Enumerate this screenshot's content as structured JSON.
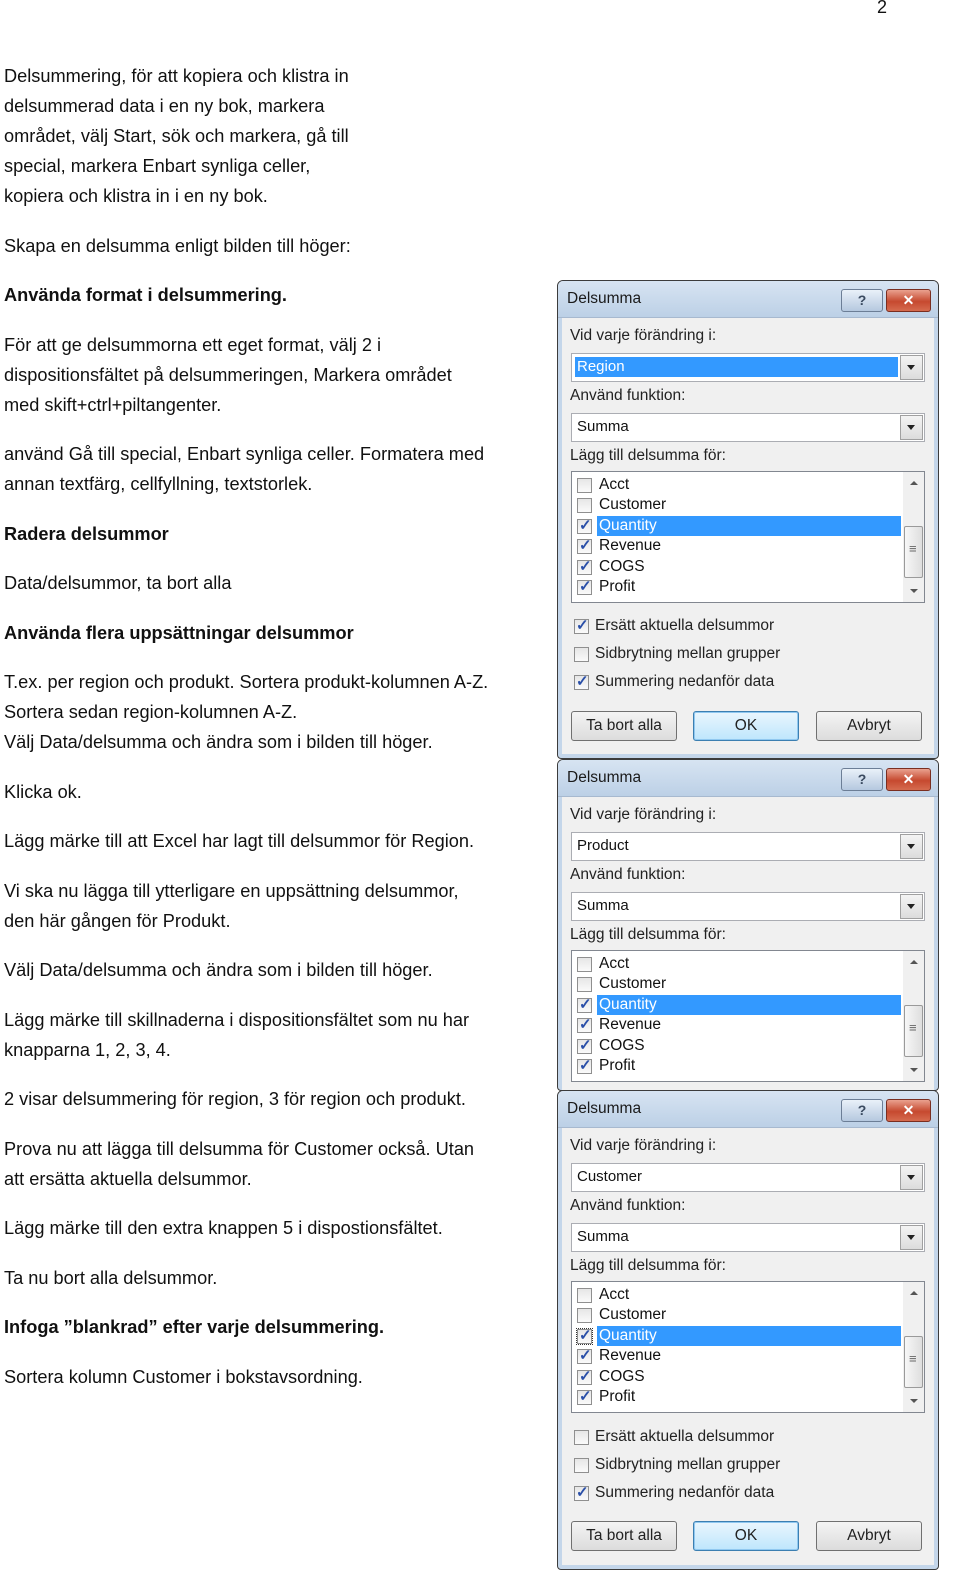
{
  "page_number": "2",
  "paragraphs": [
    {
      "bold": false,
      "lines": [
        "Delsummering, för att kopiera och klistra in",
        "delsummerad data i en ny bok, markera",
        "området, välj Start, sök och markera, gå till",
        "special, markera Enbart synliga celler,",
        "kopiera och klistra in i en ny bok."
      ]
    },
    {
      "bold": false,
      "lines": [
        "Skapa en delsumma enligt bilden till höger:"
      ]
    },
    {
      "bold": true,
      "lines": [
        "Använda format i delsummering."
      ]
    },
    {
      "bold": false,
      "lines": [
        "För att ge delsummorna ett eget format, välj 2 i",
        "dispositionsfältet på delsummeringen, Markera området",
        "med skift+ctrl+piltangenter."
      ]
    },
    {
      "bold": false,
      "lines": [
        "använd Gå till special, Enbart synliga celler. Formatera med",
        "annan textfärg, cellfyllning, textstorlek."
      ]
    },
    {
      "bold": true,
      "lines": [
        "Radera delsummor"
      ]
    },
    {
      "bold": false,
      "lines": [
        "Data/delsummor, ta bort alla"
      ]
    },
    {
      "bold": true,
      "lines": [
        "Använda flera uppsättningar delsummor"
      ]
    },
    {
      "bold": false,
      "lines": [
        "T.ex. per region och produkt. Sortera produkt-kolumnen A-Z.",
        "Sortera sedan region-kolumnen A-Z.",
        "Välj Data/delsumma och ändra som i bilden till höger."
      ]
    },
    {
      "bold": false,
      "lines": [
        "Klicka ok."
      ]
    },
    {
      "bold": false,
      "lines": [
        "Lägg märke till att Excel har lagt till delsummor för Region."
      ]
    },
    {
      "bold": false,
      "lines": [
        "Vi ska nu lägga till ytterligare en uppsättning delsummor,",
        "den här gången för Produkt."
      ]
    },
    {
      "bold": false,
      "lines": [
        "Välj Data/delsumma och ändra som i bilden till höger."
      ]
    },
    {
      "bold": false,
      "lines": [
        "Lägg märke till skillnaderna i dispositionsfältet som nu har",
        "knapparna 1, 2, 3, 4."
      ]
    },
    {
      "bold": false,
      "lines": [
        "2 visar delsummering för region, 3 för region och produkt."
      ]
    },
    {
      "bold": false,
      "lines": [
        "Prova nu att lägga till delsumma för Customer också. Utan",
        "att ersätta aktuella delsummor."
      ]
    },
    {
      "bold": false,
      "lines": [
        "Lägg märke till den extra knappen 5 i dispostionsfältet."
      ]
    },
    {
      "bold": false,
      "lines": [
        "Ta nu bort alla delsummor."
      ]
    },
    {
      "bold": true,
      "lines": [
        "Infoga ”blankrad” efter varje delsummering."
      ]
    },
    {
      "bold": false,
      "lines": [
        "Sortera kolumn Customer i bokstavsordning."
      ]
    }
  ],
  "dialog_common": {
    "title": "Delsumma",
    "help_glyph": "?",
    "close_glyph": "✕",
    "change_label": "Vid varje förändring i:",
    "function_label": "Använd funktion:",
    "add_label": "Lägg till delsumma för:",
    "replace_label": "Ersätt aktuella delsummor",
    "pagebreak_label": "Sidbrytning mellan grupper",
    "summary_label": "Summering nedanför data",
    "remove_all_label": "Ta bort alla",
    "ok_label": "OK",
    "cancel_label": "Avbryt"
  },
  "dialogs": [
    {
      "change_value": "Region",
      "function_value": "Summa",
      "fields": [
        {
          "label": "Acct",
          "checked": false
        },
        {
          "label": "Customer",
          "checked": false
        },
        {
          "label": "Quantity",
          "checked": true,
          "selected": true
        },
        {
          "label": "Revenue",
          "checked": true
        },
        {
          "label": "COGS",
          "checked": true
        },
        {
          "label": "Profit",
          "checked": true
        }
      ],
      "replace_checked": true,
      "pagebreak_checked": false,
      "summary_checked": true
    },
    {
      "change_value": "Product",
      "function_value": "Summa",
      "fields": [
        {
          "label": "Acct",
          "checked": false
        },
        {
          "label": "Customer",
          "checked": false
        },
        {
          "label": "Quantity",
          "checked": true,
          "selected": true
        },
        {
          "label": "Revenue",
          "checked": true
        },
        {
          "label": "COGS",
          "checked": true
        },
        {
          "label": "Profit",
          "checked": true
        }
      ]
    },
    {
      "change_value": "Customer",
      "function_value": "Summa",
      "fields": [
        {
          "label": "Acct",
          "checked": false
        },
        {
          "label": "Customer",
          "checked": false
        },
        {
          "label": "Quantity",
          "checked": true,
          "selected": true
        },
        {
          "label": "Revenue",
          "checked": true
        },
        {
          "label": "COGS",
          "checked": true
        },
        {
          "label": "Profit",
          "checked": true
        }
      ],
      "replace_checked": false,
      "pagebreak_checked": false,
      "summary_checked": true
    }
  ]
}
